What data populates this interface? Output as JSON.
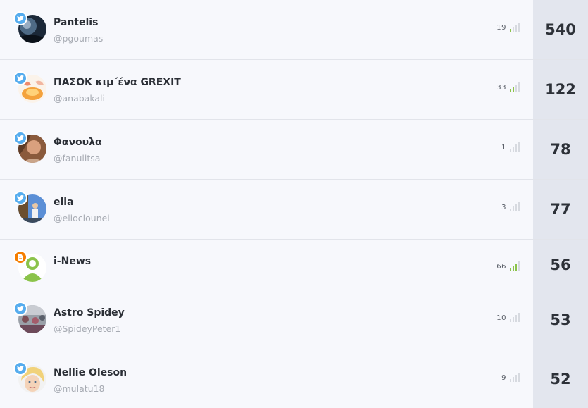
{
  "rows": [
    {
      "name": "Pantelis",
      "handle": "@pgoumas",
      "metric": "19",
      "level": 0.2,
      "score": "540",
      "source": "twitter-icon",
      "avatar": "avatar-night-sky"
    },
    {
      "name": "ΠΑΣΟΚ κιμ΄ένα GREXIT",
      "handle": "@anabakali",
      "metric": "33",
      "level": 0.4,
      "score": "122",
      "source": "twitter-icon",
      "avatar": "avatar-eggs"
    },
    {
      "name": "Φανουλα",
      "handle": "@fanulitsa",
      "metric": "1",
      "level": 0.0,
      "score": "78",
      "source": "twitter-icon",
      "avatar": "avatar-portrait"
    },
    {
      "name": "elia",
      "handle": "@elioclounei",
      "metric": "3",
      "level": 0.0,
      "score": "77",
      "source": "twitter-icon",
      "avatar": "avatar-person-sky"
    },
    {
      "name": "i-News",
      "handle": "",
      "metric": "66",
      "level": 0.8,
      "score": "56",
      "source": "blogger-icon",
      "avatar": "avatar-default-user"
    },
    {
      "name": "Astro Spidey",
      "handle": "@SpideyPeter1",
      "metric": "10",
      "level": 0.0,
      "score": "53",
      "source": "twitter-icon",
      "avatar": "avatar-crowd"
    },
    {
      "name": "Nellie Oleson",
      "handle": "@mulatu18",
      "metric": "9",
      "level": 0.0,
      "score": "52",
      "source": "twitter-icon",
      "avatar": "avatar-blonde-face"
    }
  ],
  "colors": {
    "twitter": "#55acee",
    "blogger": "#f57d00",
    "signal_on": "#8bc34a",
    "signal_off": "#d7dae0",
    "score_bg": "#e3e6ee"
  }
}
